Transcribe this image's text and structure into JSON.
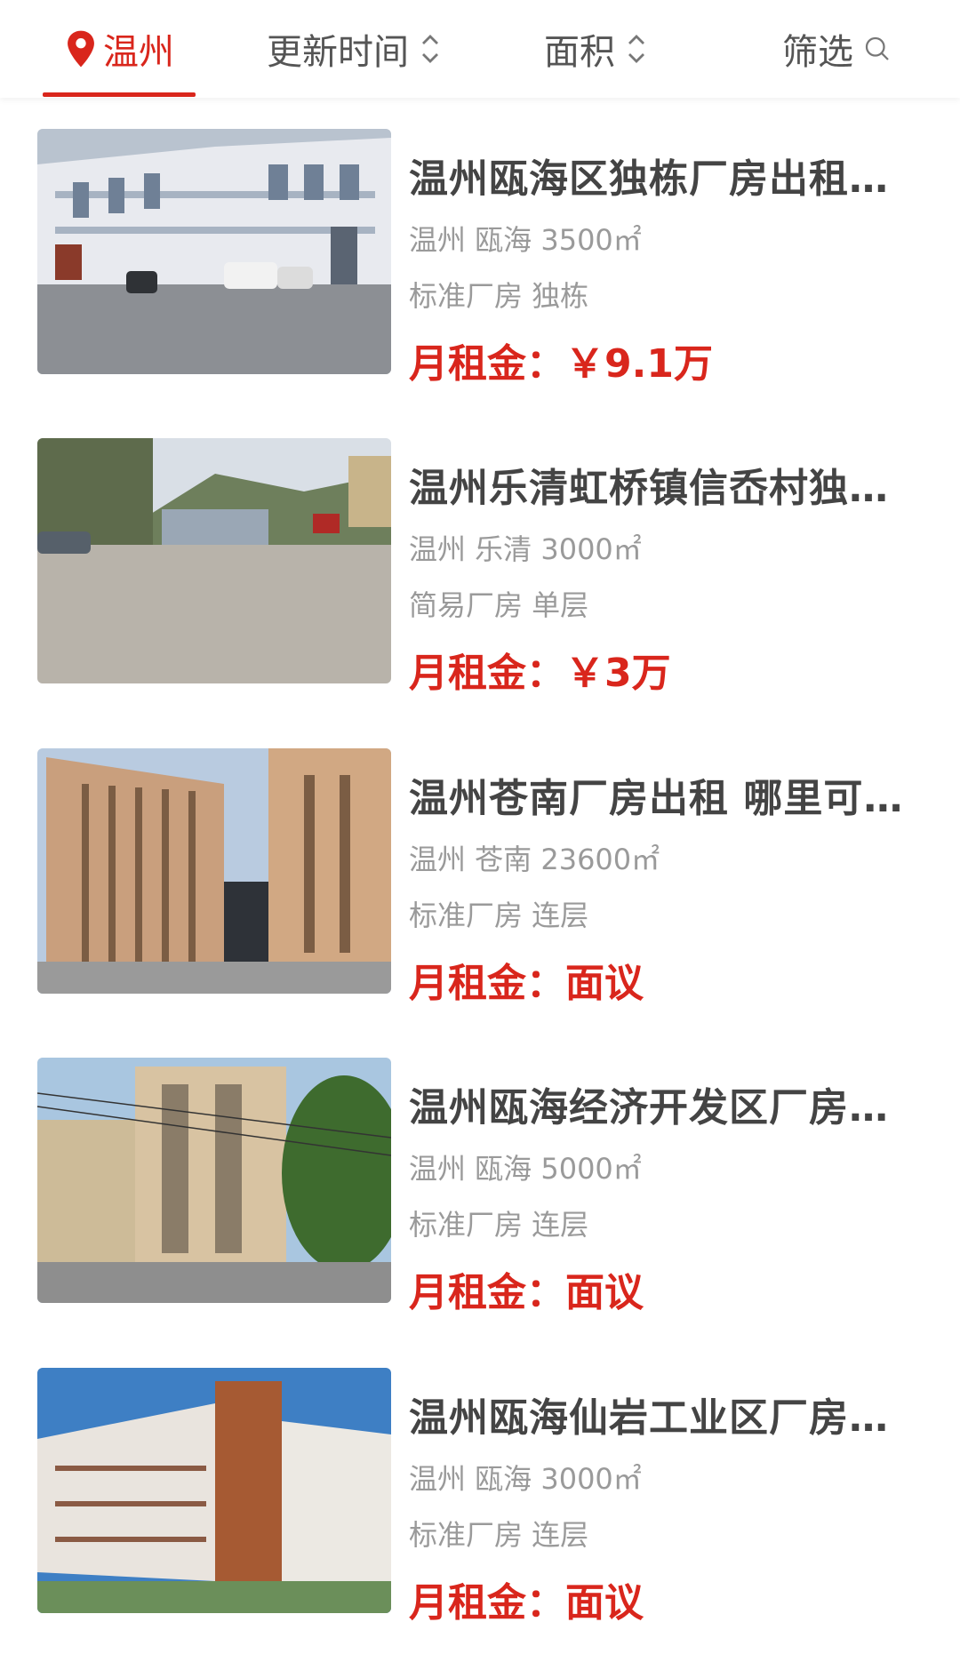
{
  "filter_bar": {
    "location_label": "温州",
    "update_time_label": "更新时间",
    "area_label": "面积",
    "screen_label": "筛选"
  },
  "listings": [
    {
      "title": "温州瓯海区独栋厂房出租…",
      "location": "温州 瓯海 3500㎡",
      "type": "标准厂房 独栋",
      "price_label": "月租金：",
      "price_value": "￥9.1万"
    },
    {
      "title": "温州乐清虹桥镇信岙村独…",
      "location": "温州 乐清 3000㎡",
      "type": "简易厂房 单层",
      "price_label": "月租金：",
      "price_value": "￥3万"
    },
    {
      "title": "温州苍南厂房出租 哪里可…",
      "location": "温州 苍南 23600㎡",
      "type": "标准厂房 连层",
      "price_label": "月租金：",
      "price_value": "面议"
    },
    {
      "title": "温州瓯海经济开发区厂房…",
      "location": "温州 瓯海 5000㎡",
      "type": "标准厂房 连层",
      "price_label": "月租金：",
      "price_value": "面议"
    },
    {
      "title": "温州瓯海仙岩工业区厂房…",
      "location": "温州 瓯海 3000㎡",
      "type": "标准厂房 连层",
      "price_label": "月租金：",
      "price_value": "面议"
    }
  ],
  "colors": {
    "accent": "#d9261c",
    "title": "#444444",
    "meta": "#9a9a9a"
  }
}
